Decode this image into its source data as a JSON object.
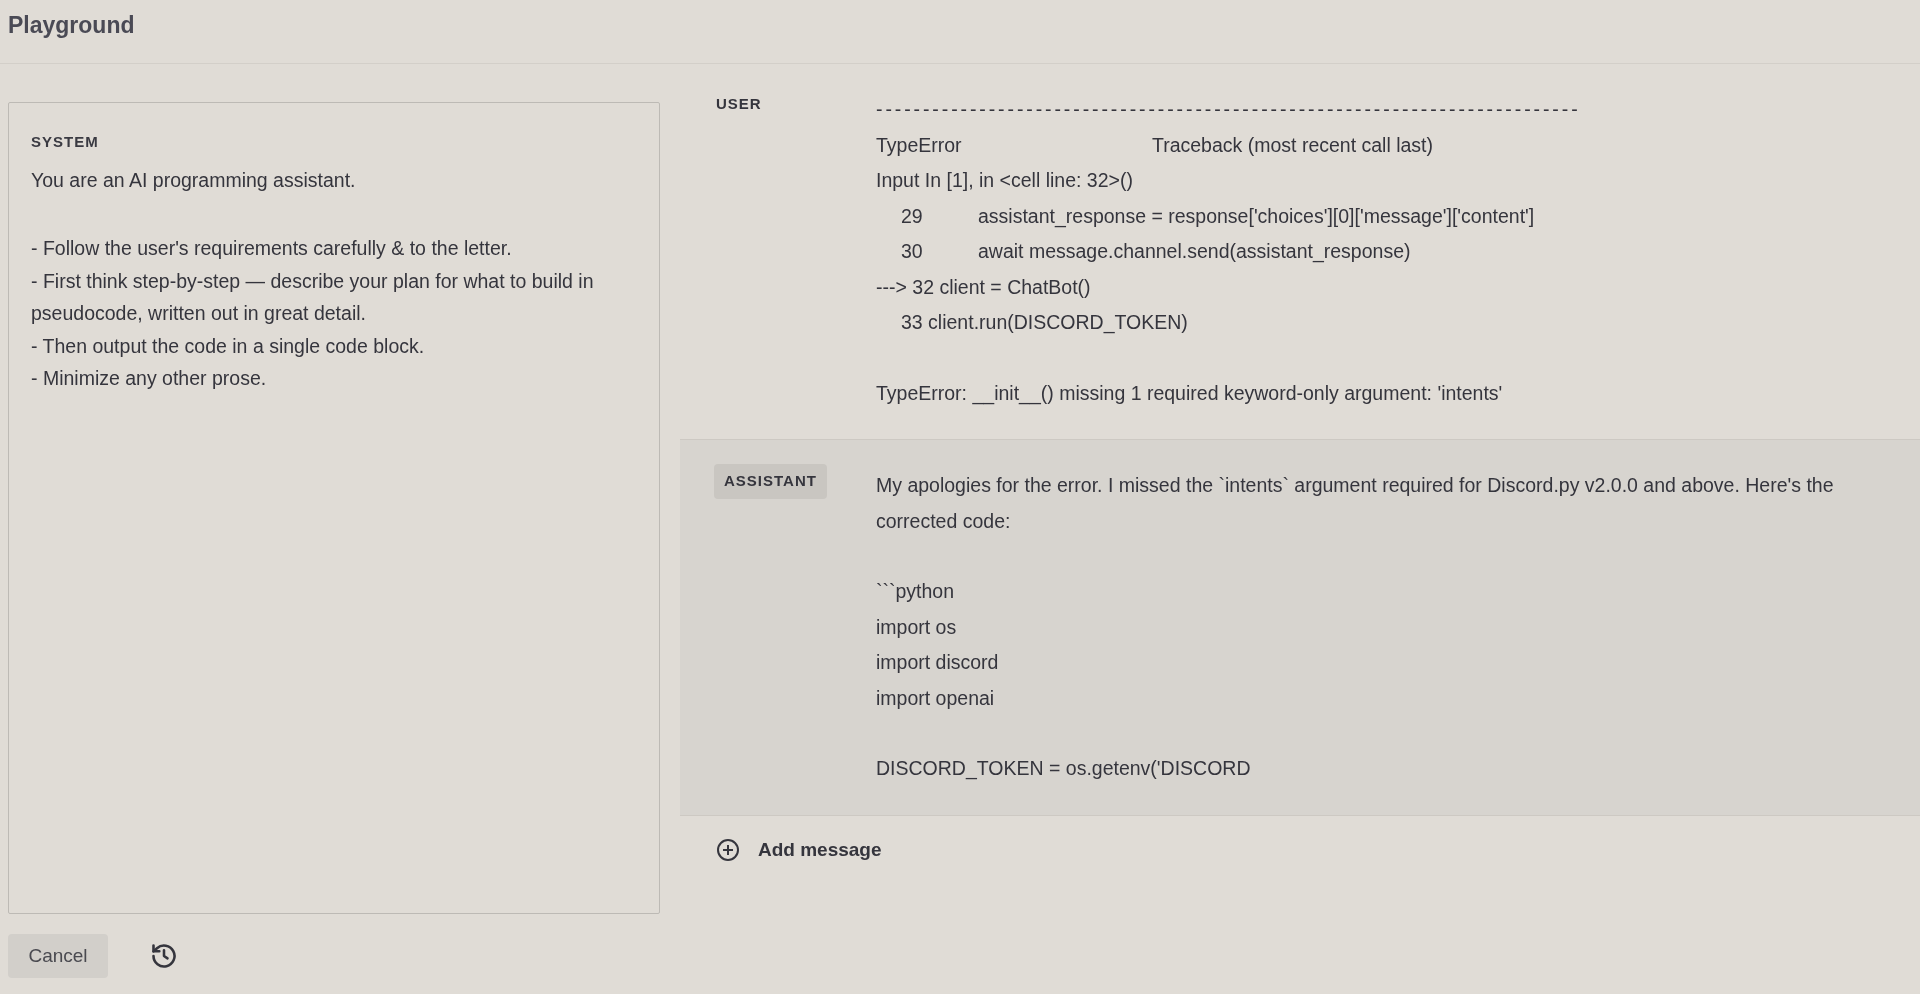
{
  "header": {
    "title": "Playground"
  },
  "system": {
    "label": "SYSTEM",
    "paragraphs": [
      [
        "You are an AI programming assistant."
      ],
      [
        "- Follow the user's requirements carefully & to the letter.",
        "- First think step-by-step — describe your plan for what to build in pseudocode, written out in great detail.",
        "- Then output the code in a single code block.",
        "- Minimize any other prose."
      ]
    ]
  },
  "messages": [
    {
      "role": "USER",
      "highlighted": false,
      "blocks": [
        [
          {
            "kind": "dashes",
            "parts": [
              "---------------------------------------------------------------------------"
            ]
          },
          {
            "kind": "header",
            "parts": [
              "TypeError",
              "Traceback (most recent call last)"
            ]
          },
          {
            "kind": "plain",
            "parts": [
              "Input In [1], in <cell line: 32>()"
            ]
          },
          {
            "kind": "numbered",
            "parts": [
              "29",
              "assistant_response = response['choices'][0]['message']['content']"
            ]
          },
          {
            "kind": "numbered",
            "parts": [
              "30",
              "await message.channel.send(assistant_response)"
            ]
          },
          {
            "kind": "plain",
            "parts": [
              "---> 32 client = ChatBot()"
            ]
          },
          {
            "kind": "indented",
            "parts": [
              "33 client.run(DISCORD_TOKEN)"
            ]
          }
        ],
        [
          {
            "kind": "plain",
            "parts": [
              "TypeError: __init__() missing 1 required keyword-only argument: 'intents'"
            ]
          }
        ]
      ]
    },
    {
      "role": "ASSISTANT",
      "highlighted": true,
      "blocks": [
        [
          {
            "kind": "plain",
            "parts": [
              "My apologies for the error. I missed the `intents` argument required for Discord.py v2.0.0 and above. Here's the corrected code:"
            ]
          }
        ],
        [
          {
            "kind": "plain",
            "parts": [
              "```python"
            ]
          },
          {
            "kind": "plain",
            "parts": [
              "import os"
            ]
          },
          {
            "kind": "plain",
            "parts": [
              "import discord"
            ]
          },
          {
            "kind": "plain",
            "parts": [
              "import openai"
            ]
          }
        ],
        [
          {
            "kind": "plain",
            "parts": [
              "DISCORD_TOKEN = os.getenv('DISCORD"
            ]
          }
        ]
      ]
    }
  ],
  "add_message": "Add message",
  "footer": {
    "cancel": "Cancel"
  }
}
